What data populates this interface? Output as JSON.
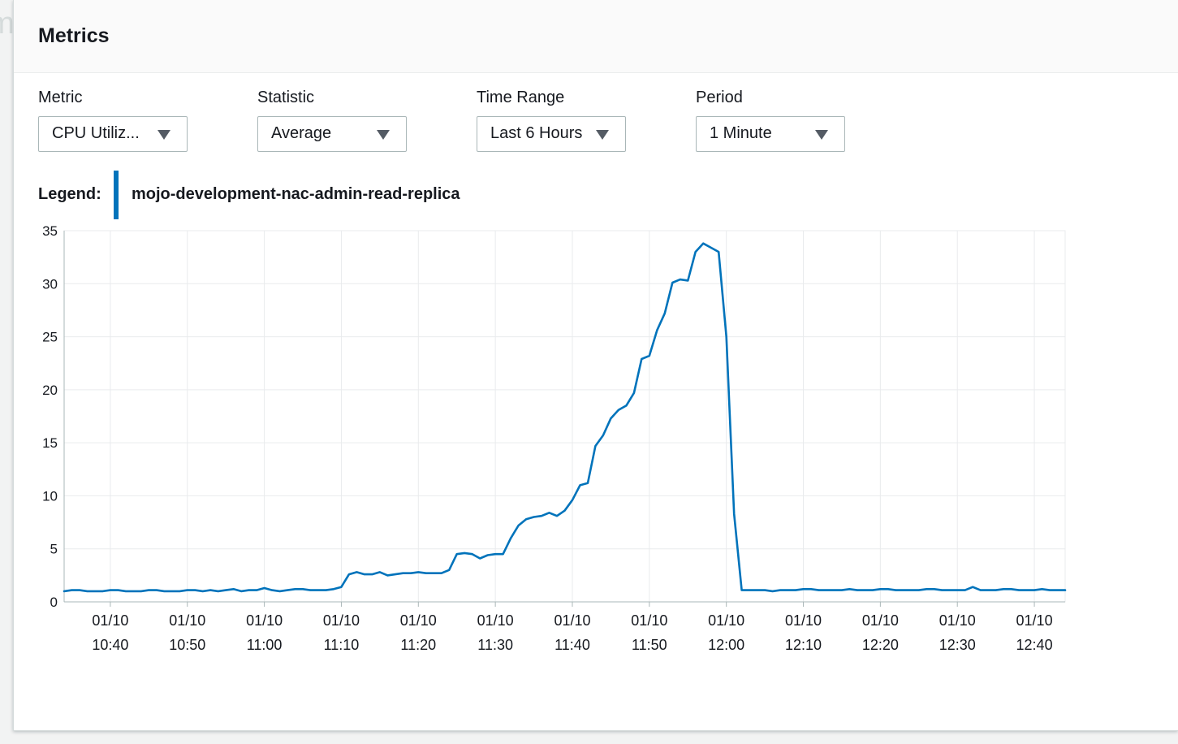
{
  "background": {
    "text": "m"
  },
  "panel": {
    "title": "Metrics"
  },
  "controls": {
    "metric": {
      "label": "Metric",
      "value": "CPU Utiliz..."
    },
    "statistic": {
      "label": "Statistic",
      "value": "Average"
    },
    "time_range": {
      "label": "Time Range",
      "value": "Last 6 Hours"
    },
    "period": {
      "label": "Period",
      "value": "1 Minute"
    }
  },
  "legend": {
    "label": "Legend:",
    "series": "mojo-development-nac-admin-read-replica"
  },
  "colors": {
    "series": "#0073bb",
    "grid": "#e9ebed",
    "axis": "#aab7b8"
  },
  "icons": {
    "dropdown": "caret-down-icon"
  },
  "chart_data": {
    "type": "line",
    "title": "",
    "xlabel": "",
    "ylabel": "",
    "ylim": [
      0,
      35
    ],
    "yticks": [
      0,
      5,
      10,
      15,
      20,
      25,
      30,
      35
    ],
    "xlim": [
      "10:34",
      "12:44"
    ],
    "x_tick_date": "01/10",
    "x_tick_times": [
      "10:40",
      "10:50",
      "11:00",
      "11:10",
      "11:20",
      "11:30",
      "11:40",
      "11:50",
      "12:00",
      "12:10",
      "12:20",
      "12:30",
      "12:40"
    ],
    "grid": true,
    "legend_position": "top-left",
    "series": [
      {
        "name": "mojo-development-nac-admin-read-replica",
        "x": [
          "10:34",
          "10:35",
          "10:36",
          "10:37",
          "10:38",
          "10:39",
          "10:40",
          "10:41",
          "10:42",
          "10:43",
          "10:44",
          "10:45",
          "10:46",
          "10:47",
          "10:48",
          "10:49",
          "10:50",
          "10:51",
          "10:52",
          "10:53",
          "10:54",
          "10:55",
          "10:56",
          "10:57",
          "10:58",
          "10:59",
          "11:00",
          "11:01",
          "11:02",
          "11:03",
          "11:04",
          "11:05",
          "11:06",
          "11:07",
          "11:08",
          "11:09",
          "11:10",
          "11:11",
          "11:12",
          "11:13",
          "11:14",
          "11:15",
          "11:16",
          "11:17",
          "11:18",
          "11:19",
          "11:20",
          "11:21",
          "11:22",
          "11:23",
          "11:24",
          "11:25",
          "11:26",
          "11:27",
          "11:28",
          "11:29",
          "11:30",
          "11:31",
          "11:32",
          "11:33",
          "11:34",
          "11:35",
          "11:36",
          "11:37",
          "11:38",
          "11:39",
          "11:40",
          "11:41",
          "11:42",
          "11:43",
          "11:44",
          "11:45",
          "11:46",
          "11:47",
          "11:48",
          "11:49",
          "11:50",
          "11:51",
          "11:52",
          "11:53",
          "11:54",
          "11:55",
          "11:56",
          "11:57",
          "11:58",
          "11:59",
          "12:00",
          "12:01",
          "12:02",
          "12:03",
          "12:04",
          "12:05",
          "12:06",
          "12:07",
          "12:08",
          "12:09",
          "12:10",
          "12:11",
          "12:12",
          "12:13",
          "12:14",
          "12:15",
          "12:16",
          "12:17",
          "12:18",
          "12:19",
          "12:20",
          "12:21",
          "12:22",
          "12:23",
          "12:24",
          "12:25",
          "12:26",
          "12:27",
          "12:28",
          "12:29",
          "12:30",
          "12:31",
          "12:32",
          "12:33",
          "12:34",
          "12:35",
          "12:36",
          "12:37",
          "12:38",
          "12:39",
          "12:40",
          "12:41",
          "12:42",
          "12:43",
          "12:44"
        ],
        "values": [
          1.0,
          1.1,
          1.1,
          1.0,
          1.0,
          1.0,
          1.1,
          1.1,
          1.0,
          1.0,
          1.0,
          1.1,
          1.1,
          1.0,
          1.0,
          1.0,
          1.1,
          1.1,
          1.0,
          1.1,
          1.0,
          1.1,
          1.2,
          1.0,
          1.1,
          1.1,
          1.3,
          1.1,
          1.0,
          1.1,
          1.2,
          1.2,
          1.1,
          1.1,
          1.1,
          1.2,
          1.4,
          2.6,
          2.8,
          2.6,
          2.6,
          2.8,
          2.5,
          2.6,
          2.7,
          2.7,
          2.8,
          2.7,
          2.7,
          2.7,
          3.0,
          4.5,
          4.6,
          4.5,
          4.1,
          4.4,
          4.5,
          4.5,
          6.0,
          7.2,
          7.8,
          8.0,
          8.1,
          8.4,
          8.1,
          8.6,
          9.6,
          11.0,
          11.2,
          14.7,
          15.7,
          17.3,
          18.1,
          18.5,
          19.7,
          22.9,
          23.2,
          25.6,
          27.2,
          30.1,
          30.4,
          30.3,
          33.0,
          33.8,
          33.4,
          33.0,
          25.0,
          8.3,
          1.1,
          1.1,
          1.1,
          1.1,
          1.0,
          1.1,
          1.1,
          1.1,
          1.2,
          1.2,
          1.1,
          1.1,
          1.1,
          1.1,
          1.2,
          1.1,
          1.1,
          1.1,
          1.2,
          1.2,
          1.1,
          1.1,
          1.1,
          1.1,
          1.2,
          1.2,
          1.1,
          1.1,
          1.1,
          1.1,
          1.4,
          1.1,
          1.1,
          1.1,
          1.2,
          1.2,
          1.1,
          1.1,
          1.1,
          1.2,
          1.1,
          1.1,
          1.1
        ]
      }
    ]
  }
}
